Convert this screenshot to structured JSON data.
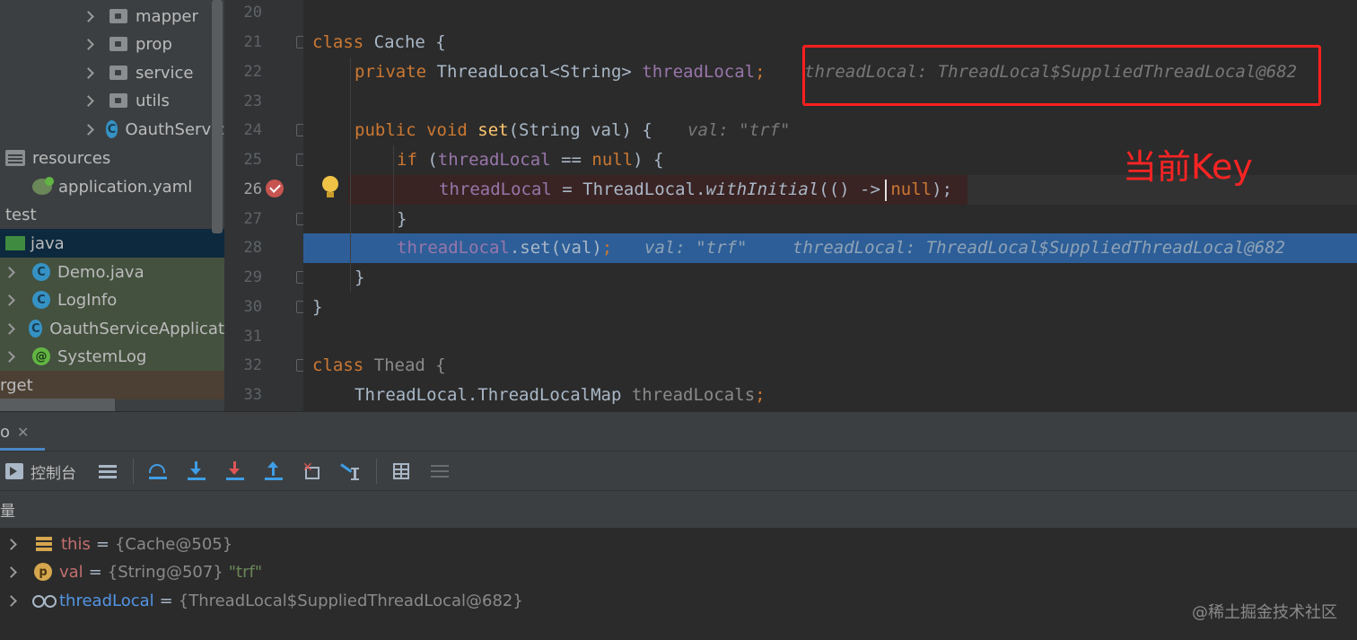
{
  "tree": {
    "items": [
      {
        "label": "mapper",
        "kind": "folder"
      },
      {
        "label": "prop",
        "kind": "folder"
      },
      {
        "label": "service",
        "kind": "folder"
      },
      {
        "label": "utils",
        "kind": "folder"
      },
      {
        "label": "OauthServic",
        "kind": "spring-class"
      },
      {
        "label": "resources",
        "kind": "resources"
      },
      {
        "label": "application.yaml",
        "kind": "yaml"
      },
      {
        "label": "test",
        "kind": "plain"
      },
      {
        "label": "java",
        "kind": "package"
      },
      {
        "label": "Demo.java",
        "kind": "class"
      },
      {
        "label": "LogInfo",
        "kind": "class"
      },
      {
        "label": "OauthServiceApplicat",
        "kind": "class"
      },
      {
        "label": "SystemLog",
        "kind": "annotation"
      },
      {
        "label": "rget",
        "kind": "plain"
      }
    ]
  },
  "editor": {
    "line_numbers": [
      "20",
      "21",
      "22",
      "23",
      "24",
      "25",
      "26",
      "27",
      "28",
      "29",
      "30",
      "31",
      "32",
      "33"
    ],
    "lines": {
      "l21": {
        "kw": "class",
        "name": " Cache {"
      },
      "l22": {
        "kw": "private",
        "type": " ThreadLocal<String> ",
        "field": "threadLocal",
        "semi": ";",
        "hint": "threadLocal: ThreadLocal$SuppliedThreadLocal@682"
      },
      "l24": {
        "kw": "public void ",
        "fn": "set",
        "rest": "(String val) {",
        "hint": "val: \"trf\""
      },
      "l25": {
        "kw": "if",
        "rest1": " (",
        "field": "threadLocal",
        "rest2": " == ",
        "kw2": "null",
        "rest3": ") {"
      },
      "l26": {
        "field": "threadLocal",
        "rest1": " = ThreadLocal.",
        "method": "withInitial",
        "rest2": "(() -> ",
        "kw": "null",
        "rest3": ");"
      },
      "l27": {
        "rest": "}"
      },
      "l28": {
        "field": "threadLocal",
        "rest": ".set(val)",
        "semi": ";",
        "hint1": "val: \"trf\"",
        "hint2": "threadLocal: ThreadLocal$SuppliedThreadLocal@682"
      },
      "l29": {
        "rest": "}"
      },
      "l30": {
        "rest": "}"
      },
      "l32": {
        "kw": "class",
        "name": " Thead {"
      },
      "l33": {
        "type": "ThreadLocal.ThreadLocalMap ",
        "field": "threadLocals",
        "semi": ";"
      }
    },
    "annotation_label": "当前Key"
  },
  "debug": {
    "tab_label": "o",
    "tab_close": "✕",
    "console_label": "控制台",
    "vars_header": "量",
    "variables": [
      {
        "name": "this",
        "eq": "=",
        "value": "{Cache@505}",
        "extra": "",
        "icon": "field-icon"
      },
      {
        "name": "val",
        "eq": "=",
        "value": "{String@507}",
        "extra": "\"trf\"",
        "icon": "parameter-icon"
      },
      {
        "name": "threadLocal",
        "eq": "=",
        "value": "{ThreadLocal$SuppliedThreadLocal@682}",
        "extra": "",
        "icon": "watch-icon"
      }
    ]
  },
  "watermark": "@稀土掘金技术社区",
  "colors": {
    "keyword": "#cc7832",
    "field": "#9876aa",
    "method": "#ffc66d",
    "string": "#6a8759",
    "selection": "#2d5e98",
    "annotation_red": "#ff1f1f"
  }
}
